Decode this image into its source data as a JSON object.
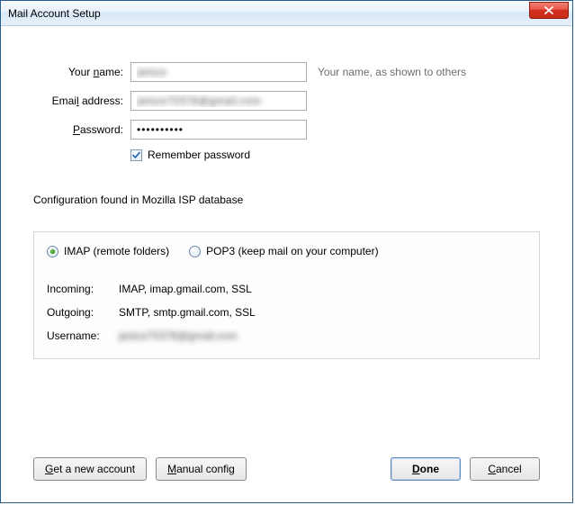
{
  "window": {
    "title": "Mail Account Setup"
  },
  "form": {
    "name": {
      "label_pre": "Your ",
      "label_u": "n",
      "label_post": "ame:",
      "value": "janice",
      "hint": "Your name, as shown to others"
    },
    "email": {
      "label_pre": "Emai",
      "label_u": "l",
      "label_post": " address:",
      "value": "janice70378@gmail.com"
    },
    "password": {
      "label_pre": "",
      "label_u": "P",
      "label_post": "assword:",
      "value": "••••••••••"
    },
    "remember": {
      "checked": true,
      "label_pre": "Re",
      "label_u": "m",
      "label_post": "ember password"
    }
  },
  "status": "Configuration found in Mozilla ISP database",
  "protocol": {
    "imap": {
      "label": "IMAP (remote folders)",
      "selected": true
    },
    "pop3": {
      "label": "POP3 (keep mail on your computer)",
      "selected": false
    }
  },
  "config": {
    "incoming": {
      "label": "Incoming:",
      "value": "IMAP, imap.gmail.com, SSL"
    },
    "outgoing": {
      "label": "Outgoing:",
      "value": "SMTP, smtp.gmail.com, SSL"
    },
    "username": {
      "label": "Username:",
      "value": "janice70378@gmail.com"
    }
  },
  "buttons": {
    "new_account": {
      "pre": "",
      "u": "G",
      "post": "et a new account"
    },
    "manual": {
      "pre": "",
      "u": "M",
      "post": "anual config"
    },
    "done": {
      "pre": "",
      "u": "D",
      "post": "one"
    },
    "cancel": {
      "pre": "",
      "u": "C",
      "post": "ancel"
    }
  }
}
